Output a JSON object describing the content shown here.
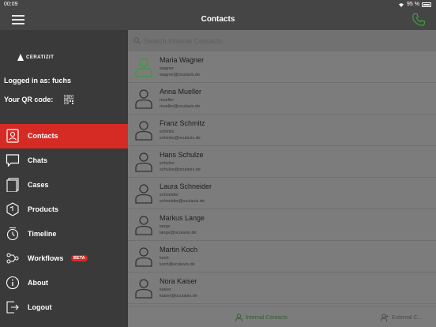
{
  "status_bar": {
    "time": "00:09",
    "battery": "95 %"
  },
  "nav": {
    "title": "Contacts"
  },
  "sidebar": {
    "logo_text": "CERATIZIT",
    "logged_in": "Logged in as: fuchs",
    "qr_label": "Your QR code:",
    "items": [
      {
        "label": "Contacts",
        "icon": "contacts-icon"
      },
      {
        "label": "Chats",
        "icon": "chat-icon"
      },
      {
        "label": "Cases",
        "icon": "cases-icon"
      },
      {
        "label": "Products",
        "icon": "products-icon"
      },
      {
        "label": "Timeline",
        "icon": "timeline-icon"
      },
      {
        "label": "Workflows",
        "icon": "workflows-icon",
        "badge": "BETA"
      },
      {
        "label": "About",
        "icon": "info-icon"
      },
      {
        "label": "Logout",
        "icon": "logout-icon"
      }
    ]
  },
  "search": {
    "placeholder": "Search Internal Contacts"
  },
  "contacts": [
    {
      "name": "Maria Wagner",
      "username": "wagner",
      "email": "wagner@oculavis.de"
    },
    {
      "name": "Anna Mueller",
      "username": "mueller",
      "email": "mueller@oculavis.de"
    },
    {
      "name": "Franz Schmitz",
      "username": "schmitz",
      "email": "schmitz@oculavis.de"
    },
    {
      "name": "Hans Schulze",
      "username": "schulze",
      "email": "schulze@oculavis.de"
    },
    {
      "name": "Laura Schneider",
      "username": "schneider",
      "email": "schneider@oculavis.de"
    },
    {
      "name": "Markus Lange",
      "username": "lange",
      "email": "lange@oculavis.de"
    },
    {
      "name": "Martin Koch",
      "username": "koch",
      "email": "koch@oculavis.de"
    },
    {
      "name": "Nora Kaiser",
      "username": "kaiser",
      "email": "kaiser@oculavis.de"
    }
  ],
  "tabs": {
    "internal": "Internal Contacts",
    "external": "External C..."
  },
  "colors": {
    "accent_red": "#d62b24",
    "online_green": "#3c9a3c"
  }
}
